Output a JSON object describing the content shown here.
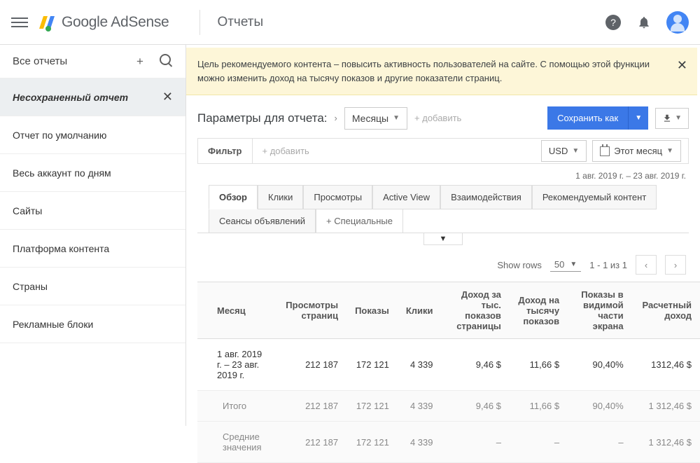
{
  "brand": "Google AdSense",
  "page_title": "Отчеты",
  "sidebar": {
    "title": "Все отчеты",
    "items": [
      "Несохраненный отчет",
      "Отчет по умолчанию",
      "Весь аккаунт по дням",
      "Сайты",
      "Платформа контента",
      "Страны",
      "Рекламные блоки"
    ]
  },
  "banner": "Цель рекомендуемого контента – повысить активность пользователей на сайте. С помощью этой функции можно изменить доход на тысячу показов и другие показатели страниц.",
  "params": {
    "title": "Параметры для отчета:",
    "dimension": "Месяцы",
    "add": "+ добавить",
    "save_as": "Сохранить как"
  },
  "filter": {
    "label": "Фильтр",
    "add": "+ добавить",
    "currency": "USD",
    "period": "Этот месяц"
  },
  "date_range": "1 авг. 2019 г. – 23 авг. 2019 г.",
  "tabs": [
    "Обзор",
    "Клики",
    "Просмотры",
    "Active View",
    "Взаимодействия",
    "Рекомендуемый контент",
    "Сеансы объявлений",
    "+ Специальные"
  ],
  "pager": {
    "show_rows": "Show rows",
    "rows": "50",
    "range": "1 - 1 из 1"
  },
  "table": {
    "headers": [
      "Месяц",
      "Просмотры страниц",
      "Показы",
      "Клики",
      "Доход за тыс. показов страницы",
      "Доход на тысячу показов",
      "Показы в видимой части экрана",
      "Расчетный доход"
    ],
    "rows": [
      {
        "label": "1 авг. 2019 г. – 23 авг. 2019 г.",
        "c": [
          "212 187",
          "172 121",
          "4 339",
          "9,46 $",
          "11,66 $",
          "90,40%",
          "1312,46 $"
        ]
      }
    ],
    "summary": [
      {
        "label": "Итого",
        "c": [
          "212 187",
          "172 121",
          "4 339",
          "9,46 $",
          "11,66 $",
          "90,40%",
          "1 312,46 $"
        ]
      },
      {
        "label": "Средние значения",
        "c": [
          "212 187",
          "172 121",
          "4 339",
          "–",
          "–",
          "–",
          "1 312,46 $"
        ]
      }
    ]
  }
}
